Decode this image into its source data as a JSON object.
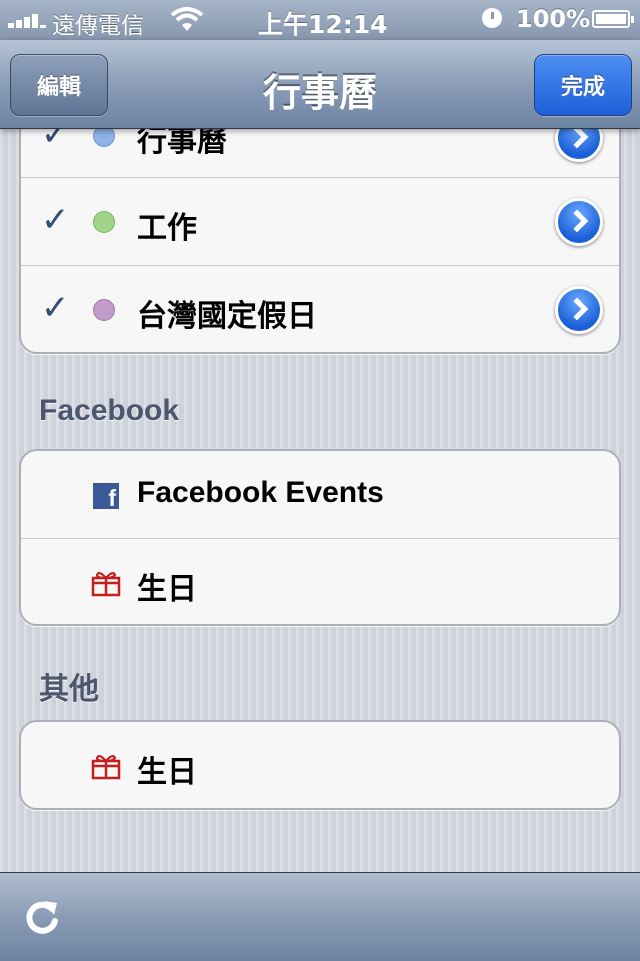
{
  "status_bar": {
    "carrier": "遠傳電信",
    "time": "上午12:14",
    "battery": "100%"
  },
  "nav": {
    "title": "行事曆",
    "edit_label": "編輯",
    "done_label": "完成"
  },
  "calendars": [
    {
      "label": "行事曆",
      "checked": true,
      "color": "#8db3e8"
    },
    {
      "label": "工作",
      "checked": true,
      "color": "#9fd489"
    },
    {
      "label": "台灣國定假日",
      "checked": true,
      "color": "#c39bc8"
    }
  ],
  "facebook_section": {
    "header": "Facebook",
    "items": [
      {
        "label": "Facebook Events",
        "icon": "facebook-icon"
      },
      {
        "label": "生日",
        "icon": "gift-icon"
      }
    ]
  },
  "other_section": {
    "header": "其他",
    "items": [
      {
        "label": "生日",
        "icon": "gift-icon"
      }
    ]
  },
  "colors": {
    "nav_bar": "#8b9db7",
    "done_button": "#2f6fe0",
    "check": "#344c76",
    "facebook": "#3b5998",
    "gift": "#c21f1f"
  }
}
